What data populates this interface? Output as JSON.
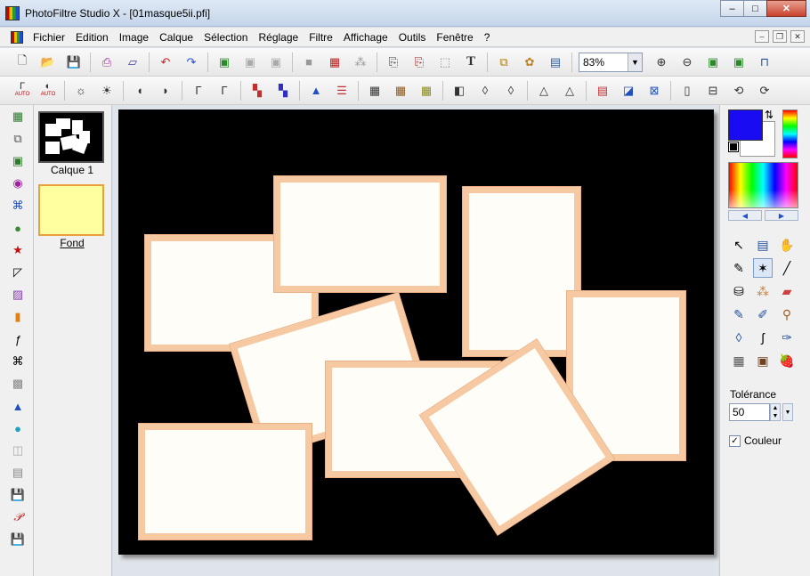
{
  "window": {
    "title": "PhotoFiltre Studio X - [01masque5ii.pfi]",
    "minimize": "–",
    "maximize": "□",
    "close": "✕"
  },
  "menubar": {
    "items": [
      "Fichier",
      "Edition",
      "Image",
      "Calque",
      "Sélection",
      "Réglage",
      "Filtre",
      "Affichage",
      "Outils",
      "Fenêtre",
      "?"
    ],
    "mdi_buttons": [
      "–",
      "❐",
      "✕"
    ]
  },
  "toolbar1": {
    "zoom_value": "83%",
    "icons": [
      "new-icon",
      "open-icon",
      "save-icon",
      "print-icon",
      "scan-icon",
      "undo-icon",
      "redo-icon",
      "paste-layer-icon",
      "copy-icon",
      "crop-icon",
      "gradient-icon",
      "color-picker-icon",
      "magic-icon",
      "text-edit-icon",
      "text-mode-icon",
      "select-rect-icon",
      "text-icon",
      "layers-icon",
      "settings-icon",
      "window-icon",
      "zoom-in-icon",
      "zoom-out-icon",
      "fit-icon",
      "fit-page-icon",
      "fullscreen-icon"
    ]
  },
  "toolbar2": {
    "labels": [
      "AUTO",
      "AUTO"
    ]
  },
  "layers": {
    "layer1_label": "Calque 1",
    "layer2_label": "Fond"
  },
  "tools_panel": {
    "tolerance_label": "Tolérance",
    "tolerance_value": "50",
    "color_checkbox_label": "Couleur",
    "color_checkbox_checked": true
  },
  "colors": {
    "foreground": "#1a0cf2",
    "background": "#ffffff",
    "frame": "#f6c9a2",
    "canvas": "#000000"
  }
}
